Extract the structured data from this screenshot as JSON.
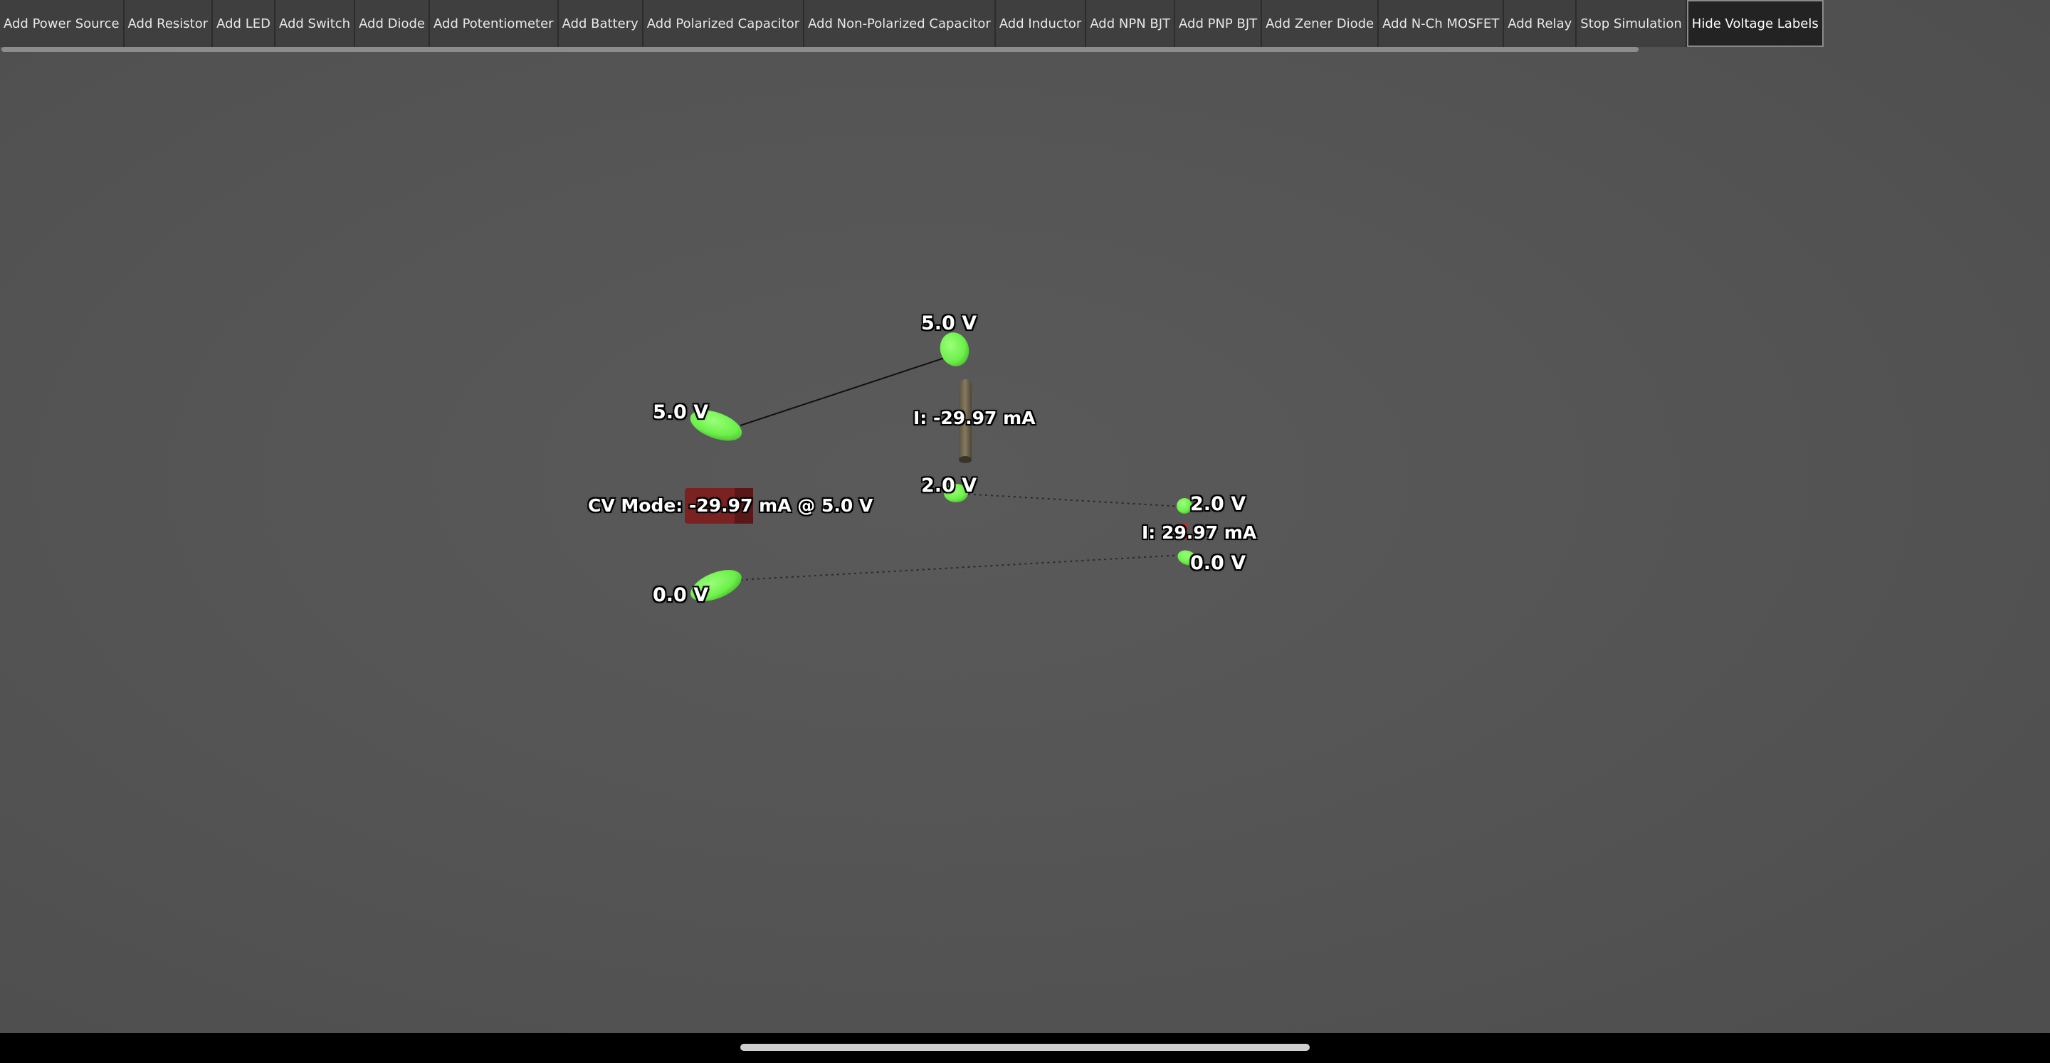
{
  "toolbar": {
    "buttons": [
      {
        "label": "Add Power Source"
      },
      {
        "label": "Add Resistor"
      },
      {
        "label": "Add LED"
      },
      {
        "label": "Add Switch"
      },
      {
        "label": "Add Diode"
      },
      {
        "label": "Add Potentiometer"
      },
      {
        "label": "Add Battery"
      },
      {
        "label": "Add Polarized Capacitor"
      },
      {
        "label": "Add Non-Polarized Capacitor"
      },
      {
        "label": "Add Inductor"
      },
      {
        "label": "Add NPN BJT"
      },
      {
        "label": "Add PNP BJT"
      },
      {
        "label": "Add Zener Diode"
      },
      {
        "label": "Add N-Ch MOSFET"
      },
      {
        "label": "Add Relay"
      },
      {
        "label": "Stop Simulation"
      },
      {
        "label": "Hide Voltage Labels"
      }
    ]
  },
  "scene": {
    "power_source": {
      "mode_label": "CV Mode: -29.97 mA @ 5.0 V",
      "color": "#7a2222"
    },
    "resistor": {
      "current_label": "I: -29.97 mA",
      "color": "#6e6552"
    },
    "led": {
      "current_label": "I: 29.97 mA",
      "color": "#c03030"
    },
    "node_color": "#6cf04a",
    "terminals": {
      "ps_pos": "5.0 V",
      "ps_neg": "0.0 V",
      "res_top": "5.0 V",
      "res_bottom": "2.0 V",
      "led_anode": "2.0 V",
      "led_cathode": "0.0 V"
    }
  }
}
